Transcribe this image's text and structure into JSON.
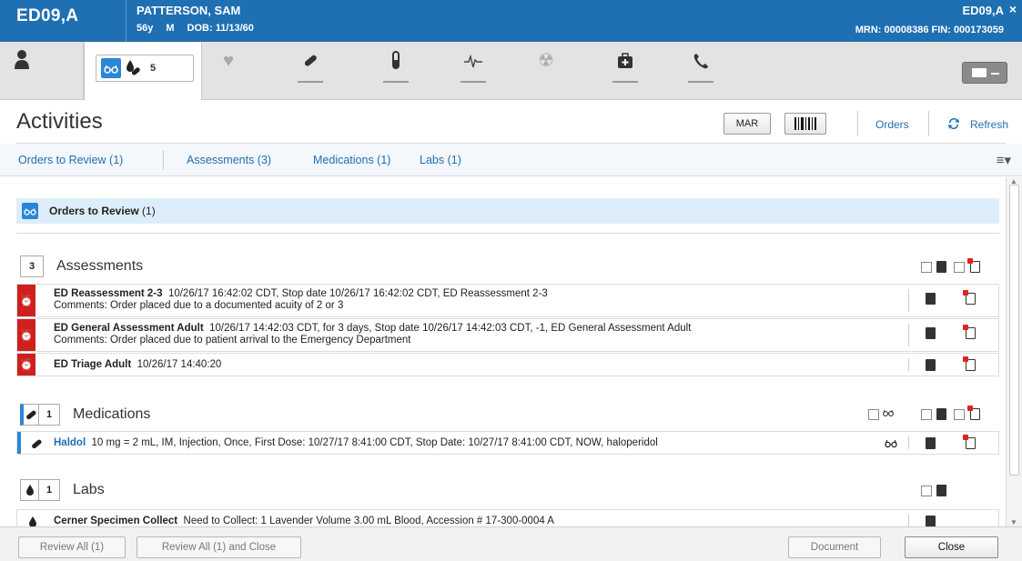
{
  "header": {
    "location": "ED09,A",
    "patient_name": "PATTERSON, SAM",
    "age": "56y",
    "sex": "M",
    "dob": "DOB: 11/13/60",
    "right_location": "ED09,A",
    "ids": "MRN: 00008386  FIN: 000173059",
    "close_glyph": "×"
  },
  "toolbar": {
    "active_count": "5"
  },
  "activities": {
    "title": "Activities",
    "mar_label": "MAR",
    "orders_link": "Orders",
    "refresh_link": "Refresh"
  },
  "nav": {
    "tabs": [
      "Orders to Review (1)",
      "Assessments (3)",
      "Medications (1)",
      "Labs (1)"
    ]
  },
  "orders_to_review": {
    "label": "Orders to Review",
    "count": "(1)"
  },
  "assessments": {
    "count": "3",
    "title": "Assessments",
    "rows": [
      {
        "name": "ED Reassessment 2-3",
        "detail": "10/26/17 16:42:02 CDT, Stop date 10/26/17 16:42:02 CDT, ED Reassessment 2-3",
        "comment": "Comments:  Order placed due to a documented acuity of 2 or 3"
      },
      {
        "name": "ED General Assessment Adult",
        "detail": "10/26/17 14:42:03 CDT, for 3 days, Stop date 10/26/17 14:42:03 CDT, -1, ED General Assessment Adult",
        "comment": "Comments:  Order placed due to patient arrival to the Emergency Department"
      },
      {
        "name": "ED Triage Adult",
        "detail": "10/26/17 14:40:20",
        "comment": ""
      }
    ]
  },
  "medications": {
    "count": "1",
    "title": "Medications",
    "rows": [
      {
        "name": "Haldol",
        "detail": "10 mg = 2 mL, IM, Injection, Once, First Dose: 10/27/17 8:41:00 CDT, Stop Date: 10/27/17 8:41:00 CDT, NOW, haloperidol"
      }
    ]
  },
  "labs": {
    "count": "1",
    "title": "Labs",
    "rows": [
      {
        "name": "Cerner Specimen Collect",
        "detail": "Need to Collect: 1 Lavender Volume 3.00 mL Blood, Accession # 17-300-0004 A"
      }
    ]
  },
  "footer": {
    "review_all": "Review All (1)",
    "review_all_close": "Review All (1) and Close",
    "document": "Document",
    "close": "Close"
  },
  "colors": {
    "header_blue": "#1f6fb3",
    "alert_red": "#cf1f1f",
    "link_blue": "#1f6fb3"
  }
}
